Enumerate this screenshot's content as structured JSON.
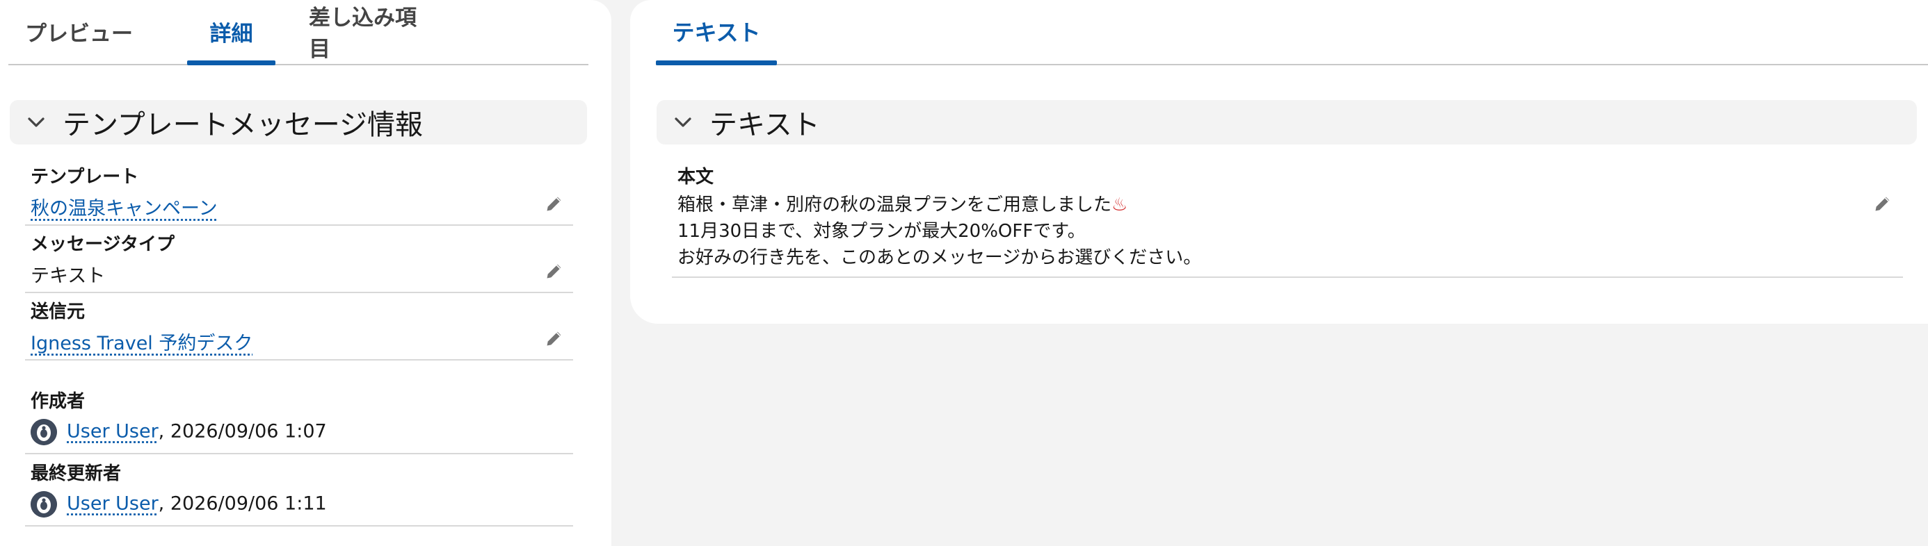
{
  "left_tabs": [
    {
      "label": "プレビュー",
      "active": false
    },
    {
      "label": "詳細",
      "active": true
    },
    {
      "label": "差し込み項目",
      "active": false
    }
  ],
  "left_section": {
    "title": "テンプレートメッセージ情報"
  },
  "fields": {
    "template": {
      "label": "テンプレート",
      "value": "秋の温泉キャンペーン"
    },
    "message_type": {
      "label": "メッセージタイプ",
      "value": "テキスト"
    },
    "sender": {
      "label": "送信元",
      "value": "Igness Travel 予約デスク"
    },
    "created_by": {
      "label": "作成者",
      "user": "User User",
      "timestamp": ", 2026/09/06 1:07"
    },
    "modified_by": {
      "label": "最終更新者",
      "user": "User User",
      "timestamp": ", 2026/09/06 1:11"
    }
  },
  "right_tabs": [
    {
      "label": "テキスト",
      "active": true
    }
  ],
  "right_section": {
    "title": "テキスト"
  },
  "body": {
    "label": "本文",
    "line1": "箱根・草津・別府の秋の温泉プランをご用意しました",
    "line1_emoji": "♨",
    "line2": "11月30日まで、対象プランが最大20%OFFです。",
    "line3": "お好みの行き先を、このあとのメッセージからお選びください。"
  },
  "colors": {
    "link": "#0b5cab",
    "hot_spring": "#d22a2a"
  }
}
